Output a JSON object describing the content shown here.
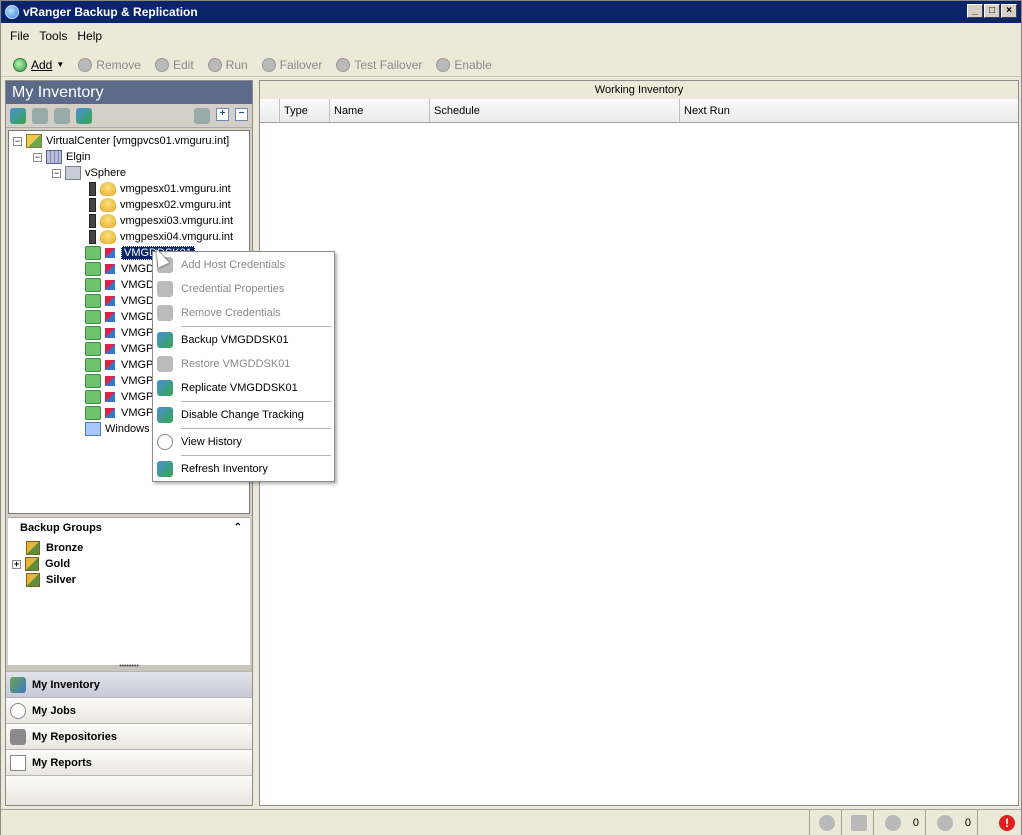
{
  "window": {
    "title": "vRanger Backup & Replication"
  },
  "menubar": {
    "items": [
      "File",
      "Tools",
      "Help"
    ]
  },
  "toolbar": {
    "add": "Add",
    "remove": "Remove",
    "edit": "Edit",
    "run": "Run",
    "failover": "Failover",
    "test_failover": "Test Failover",
    "enable": "Enable"
  },
  "left_panel": {
    "title": "My Inventory"
  },
  "tree": {
    "root": "VirtualCenter [vmgpvcs01.vmguru.int]",
    "datacenter": "Elgin",
    "cluster": "vSphere",
    "hosts": [
      "vmgpesx01.vmguru.int",
      "vmgpesx02.vmguru.int",
      "vmgpesxi03.vmguru.int",
      "vmgpesxi04.vmguru.int"
    ],
    "selected_vm": "VMGDDSK01",
    "vms": [
      "VMGD",
      "VMGD",
      "VMGD",
      "VMGD",
      "VMGP",
      "VMGP",
      "VMGP",
      "VMGP",
      "VMGP",
      "VMGP"
    ],
    "windows": "Windows"
  },
  "backup_groups": {
    "title": "Backup Groups",
    "items": [
      "Bronze",
      "Gold",
      "Silver"
    ]
  },
  "nav": {
    "inventory": "My Inventory",
    "jobs": "My Jobs",
    "repositories": "My Repositories",
    "reports": "My Reports"
  },
  "right_panel": {
    "title": "Working Inventory",
    "columns": [
      "Type",
      "Name",
      "Schedule",
      "Next Run"
    ]
  },
  "context_menu": {
    "add_host_credentials": "Add Host Credentials",
    "credential_properties": "Credential Properties",
    "remove_credentials": "Remove Credentials",
    "backup": "Backup VMGDDSK01",
    "restore": "Restore VMGDDSK01",
    "replicate": "Replicate VMGDDSK01",
    "disable_change_tracking": "Disable Change Tracking",
    "view_history": "View History",
    "refresh_inventory": "Refresh Inventory"
  },
  "statusbar": {
    "running_count": "0",
    "tasks_count": "0",
    "alert": "!"
  }
}
